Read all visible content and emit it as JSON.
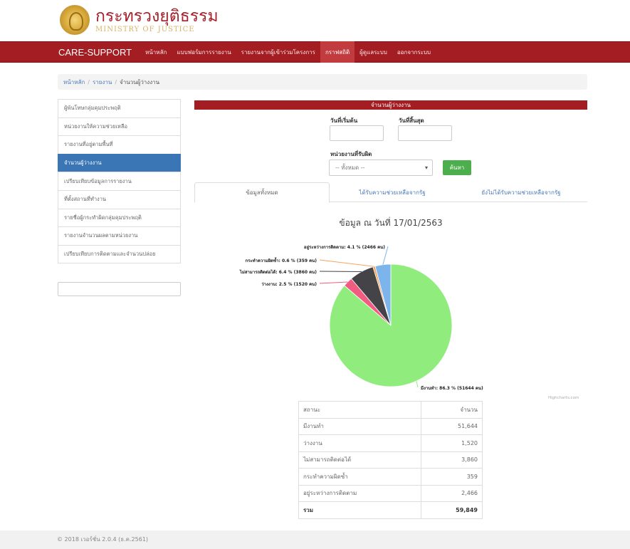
{
  "header": {
    "title_th": "กระทรวงยุติธรรม",
    "title_en": "MINISTRY OF JUSTICE"
  },
  "nav": {
    "brand": "CARE-SUPPORT",
    "items": [
      {
        "label": "หน้าหลัก",
        "active": false
      },
      {
        "label": "แบบฟอร์มการรายงาน",
        "active": false
      },
      {
        "label": "รายงานจากผู้เข้าร่วมโครงการ",
        "active": false
      },
      {
        "label": "กราฟสถิติ",
        "active": true
      },
      {
        "label": "ผู้ดูแลระบบ",
        "active": false
      },
      {
        "label": "ออกจากระบบ",
        "active": false
      }
    ]
  },
  "breadcrumb": {
    "items": [
      "หน้าหลัก",
      "รายงาน"
    ],
    "current": "จำนวนผู้ว่างงาน"
  },
  "sidebar": {
    "items": [
      {
        "label": "ผู้พ้นโทษกลุ่มคุมประพฤติ",
        "active": false
      },
      {
        "label": "หน่วยงานให้ความช่วยเหลือ",
        "active": false
      },
      {
        "label": "รายงานที่อยู่ตามพื้นที่",
        "active": false
      },
      {
        "label": "จำนวนผู้ว่างงาน",
        "active": true
      },
      {
        "label": "เปรียบเทียบข้อมูลการรายงาน",
        "active": false
      },
      {
        "label": "ที่ตั้งสถานที่ทำงาน",
        "active": false
      },
      {
        "label": "รายชื่อผู้กระทำผิดกลุ่มคุมประพฤติ",
        "active": false
      },
      {
        "label": "รายงานจำนวนผลตามหน่วยงาน",
        "active": false
      },
      {
        "label": "เปรียบเทียบการติดตามและจำนวนปล่อย",
        "active": false
      }
    ]
  },
  "panel": {
    "title": "จำนวนผู้ว่างงาน",
    "start_label": "วันที่เริ่มต้น",
    "end_label": "วันที่สิ้นสุด",
    "unit_label": "หน่วยงานที่รับผิด",
    "select_value": "-- ทั้งหมด --",
    "search_button": "ค้นหา"
  },
  "tabs": [
    {
      "label": "ข้อมูลทั้งหมด",
      "active": true
    },
    {
      "label": "ได้รับความช่วยเหลือจากรัฐ",
      "active": false
    },
    {
      "label": "ยังไม่ได้รับความช่วยเหลือจากรัฐ",
      "active": false
    }
  ],
  "chart_data": {
    "type": "pie",
    "title": "ข้อมูล ณ วันที่ 17/01/2563",
    "credits": "Highcharts.com",
    "slices": [
      {
        "name": "มีงานทำ",
        "label": "มีงานทำ: 86.3 % (51644 คน)",
        "percent": 86.3,
        "value": 51644,
        "color": "#90ed7d"
      },
      {
        "name": "ว่างงาน",
        "label": "ว่างงาน: 2.5 % (1520 คน)",
        "percent": 2.5,
        "value": 1520,
        "color": "#f15c80"
      },
      {
        "name": "ไม่สามารถติดต่อได้",
        "label": "ไม่สามารถติดต่อได้: 6.4 % (3860 คน)",
        "percent": 6.4,
        "value": 3860,
        "color": "#434348"
      },
      {
        "name": "กระทำความผิดซ้ำ",
        "label": "กระทำความผิดซ้ำ: 0.6 % (359 คน)",
        "percent": 0.6,
        "value": 359,
        "color": "#f7a35c"
      },
      {
        "name": "อยู่ระหว่างการติดตาม",
        "label": "อยู่ระหว่างการติดตาม: 4.1 % (2466 คน)",
        "percent": 4.1,
        "value": 2466,
        "color": "#7cb5ec"
      }
    ]
  },
  "table": {
    "headers": [
      "สถานะ",
      "จำนวน"
    ],
    "rows": [
      [
        "มีงานทำ",
        "51,644"
      ],
      [
        "ว่างงาน",
        "1,520"
      ],
      [
        "ไม่สามารถติดต่อได้",
        "3,860"
      ],
      [
        "กระทำความผิดซ้ำ",
        "359"
      ],
      [
        "อยู่ระหว่างการติดตาม",
        "2,466"
      ]
    ],
    "total": [
      "รวม",
      "59,849"
    ]
  },
  "footer": {
    "text": "© 2018 เวอร์ชั่น 2.0.4 (ธ.ค.2561)"
  }
}
